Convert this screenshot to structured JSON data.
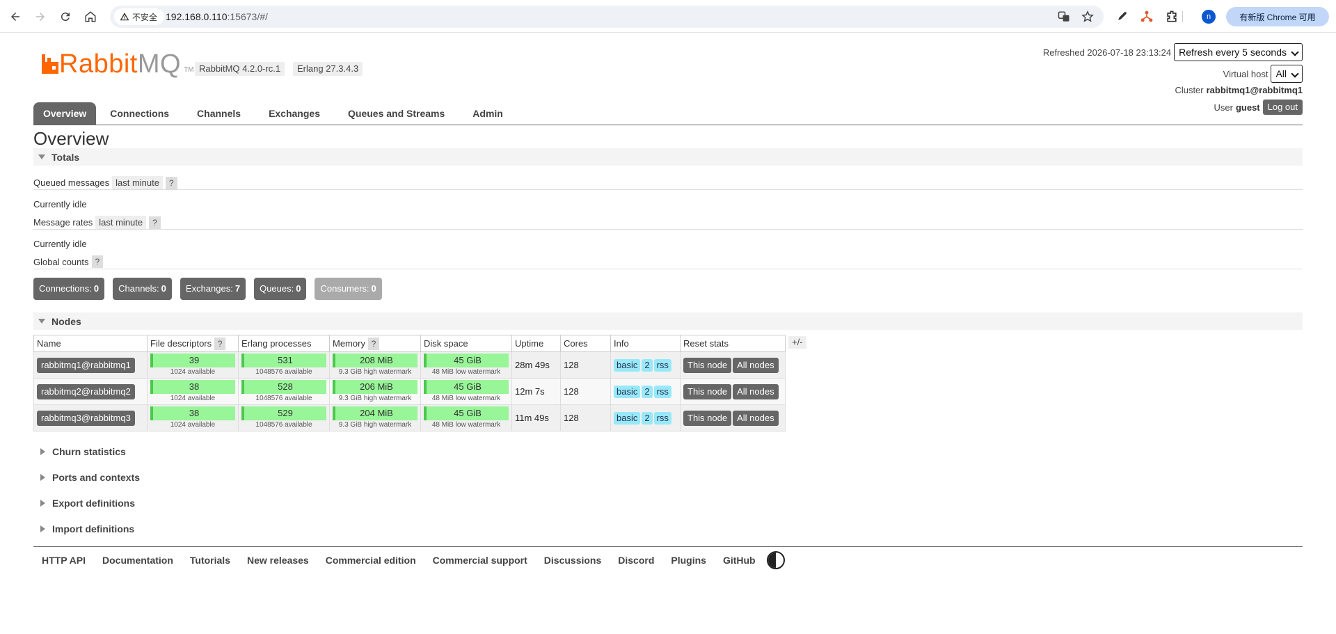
{
  "browser": {
    "security_label": "不安全",
    "url_host": "192.168.0.110",
    "url_rest": ":15673/#/",
    "update_label": "有新版 Chrome 可用",
    "profile_initial": "n"
  },
  "header": {
    "logo_main": "Rabbit",
    "logo_mq": "MQ",
    "logo_tm": "TM",
    "version": "RabbitMQ 4.2.0-rc.1",
    "erlang": "Erlang 27.3.4.3",
    "refreshed_label": "Refreshed 2026-07-18 23:13:24",
    "refresh_select": "Refresh every 5 seconds",
    "vhost_label": "Virtual host",
    "vhost_select": "All",
    "cluster_label": "Cluster",
    "cluster_name": "rabbitmq1@rabbitmq1",
    "user_label": "User",
    "user_name": "guest",
    "logout": "Log out"
  },
  "tabs": [
    "Overview",
    "Connections",
    "Channels",
    "Exchanges",
    "Queues and Streams",
    "Admin"
  ],
  "page_title": "Overview",
  "totals": {
    "header": "Totals",
    "queued_label": "Queued messages",
    "queued_range": "last minute",
    "help": "?",
    "idle_1": "Currently idle",
    "rates_label": "Message rates",
    "rates_range": "last minute",
    "idle_2": "Currently idle",
    "global_label": "Global counts"
  },
  "counts": [
    {
      "label": "Connections:",
      "value": "0"
    },
    {
      "label": "Channels:",
      "value": "0"
    },
    {
      "label": "Exchanges:",
      "value": "7"
    },
    {
      "label": "Queues:",
      "value": "0"
    },
    {
      "label": "Consumers:",
      "value": "0"
    }
  ],
  "nodes": {
    "header": "Nodes",
    "columns": [
      "Name",
      "File descriptors",
      "Erlang processes",
      "Memory",
      "Disk space",
      "Uptime",
      "Cores",
      "Info",
      "Reset stats"
    ],
    "plusminus": "+/-",
    "rows": [
      {
        "name": "rabbitmq1@rabbitmq1",
        "fd": "39",
        "fd_sub": "1024 available",
        "proc": "531",
        "proc_sub": "1048576 available",
        "mem": "208 MiB",
        "mem_sub": "9.3 GiB high watermark",
        "disk": "45 GiB",
        "disk_sub": "48 MiB low watermark",
        "uptime": "28m 49s",
        "cores": "128",
        "info": [
          "basic",
          "2",
          "rss"
        ],
        "this_node": "This node",
        "all_nodes": "All nodes"
      },
      {
        "name": "rabbitmq2@rabbitmq2",
        "fd": "38",
        "fd_sub": "1024 available",
        "proc": "528",
        "proc_sub": "1048576 available",
        "mem": "206 MiB",
        "mem_sub": "9.3 GiB high watermark",
        "disk": "45 GiB",
        "disk_sub": "48 MiB low watermark",
        "uptime": "12m 7s",
        "cores": "128",
        "info": [
          "basic",
          "2",
          "rss"
        ],
        "this_node": "This node",
        "all_nodes": "All nodes"
      },
      {
        "name": "rabbitmq3@rabbitmq3",
        "fd": "38",
        "fd_sub": "1024 available",
        "proc": "529",
        "proc_sub": "1048576 available",
        "mem": "204 MiB",
        "mem_sub": "9.3 GiB high watermark",
        "disk": "45 GiB",
        "disk_sub": "48 MiB low watermark",
        "uptime": "11m 49s",
        "cores": "128",
        "info": [
          "basic",
          "2",
          "rss"
        ],
        "this_node": "This node",
        "all_nodes": "All nodes"
      }
    ]
  },
  "collapsed_sections": [
    "Churn statistics",
    "Ports and contexts",
    "Export definitions",
    "Import definitions"
  ],
  "footer": [
    "HTTP API",
    "Documentation",
    "Tutorials",
    "New releases",
    "Commercial edition",
    "Commercial support",
    "Discussions",
    "Discord",
    "Plugins",
    "GitHub"
  ]
}
